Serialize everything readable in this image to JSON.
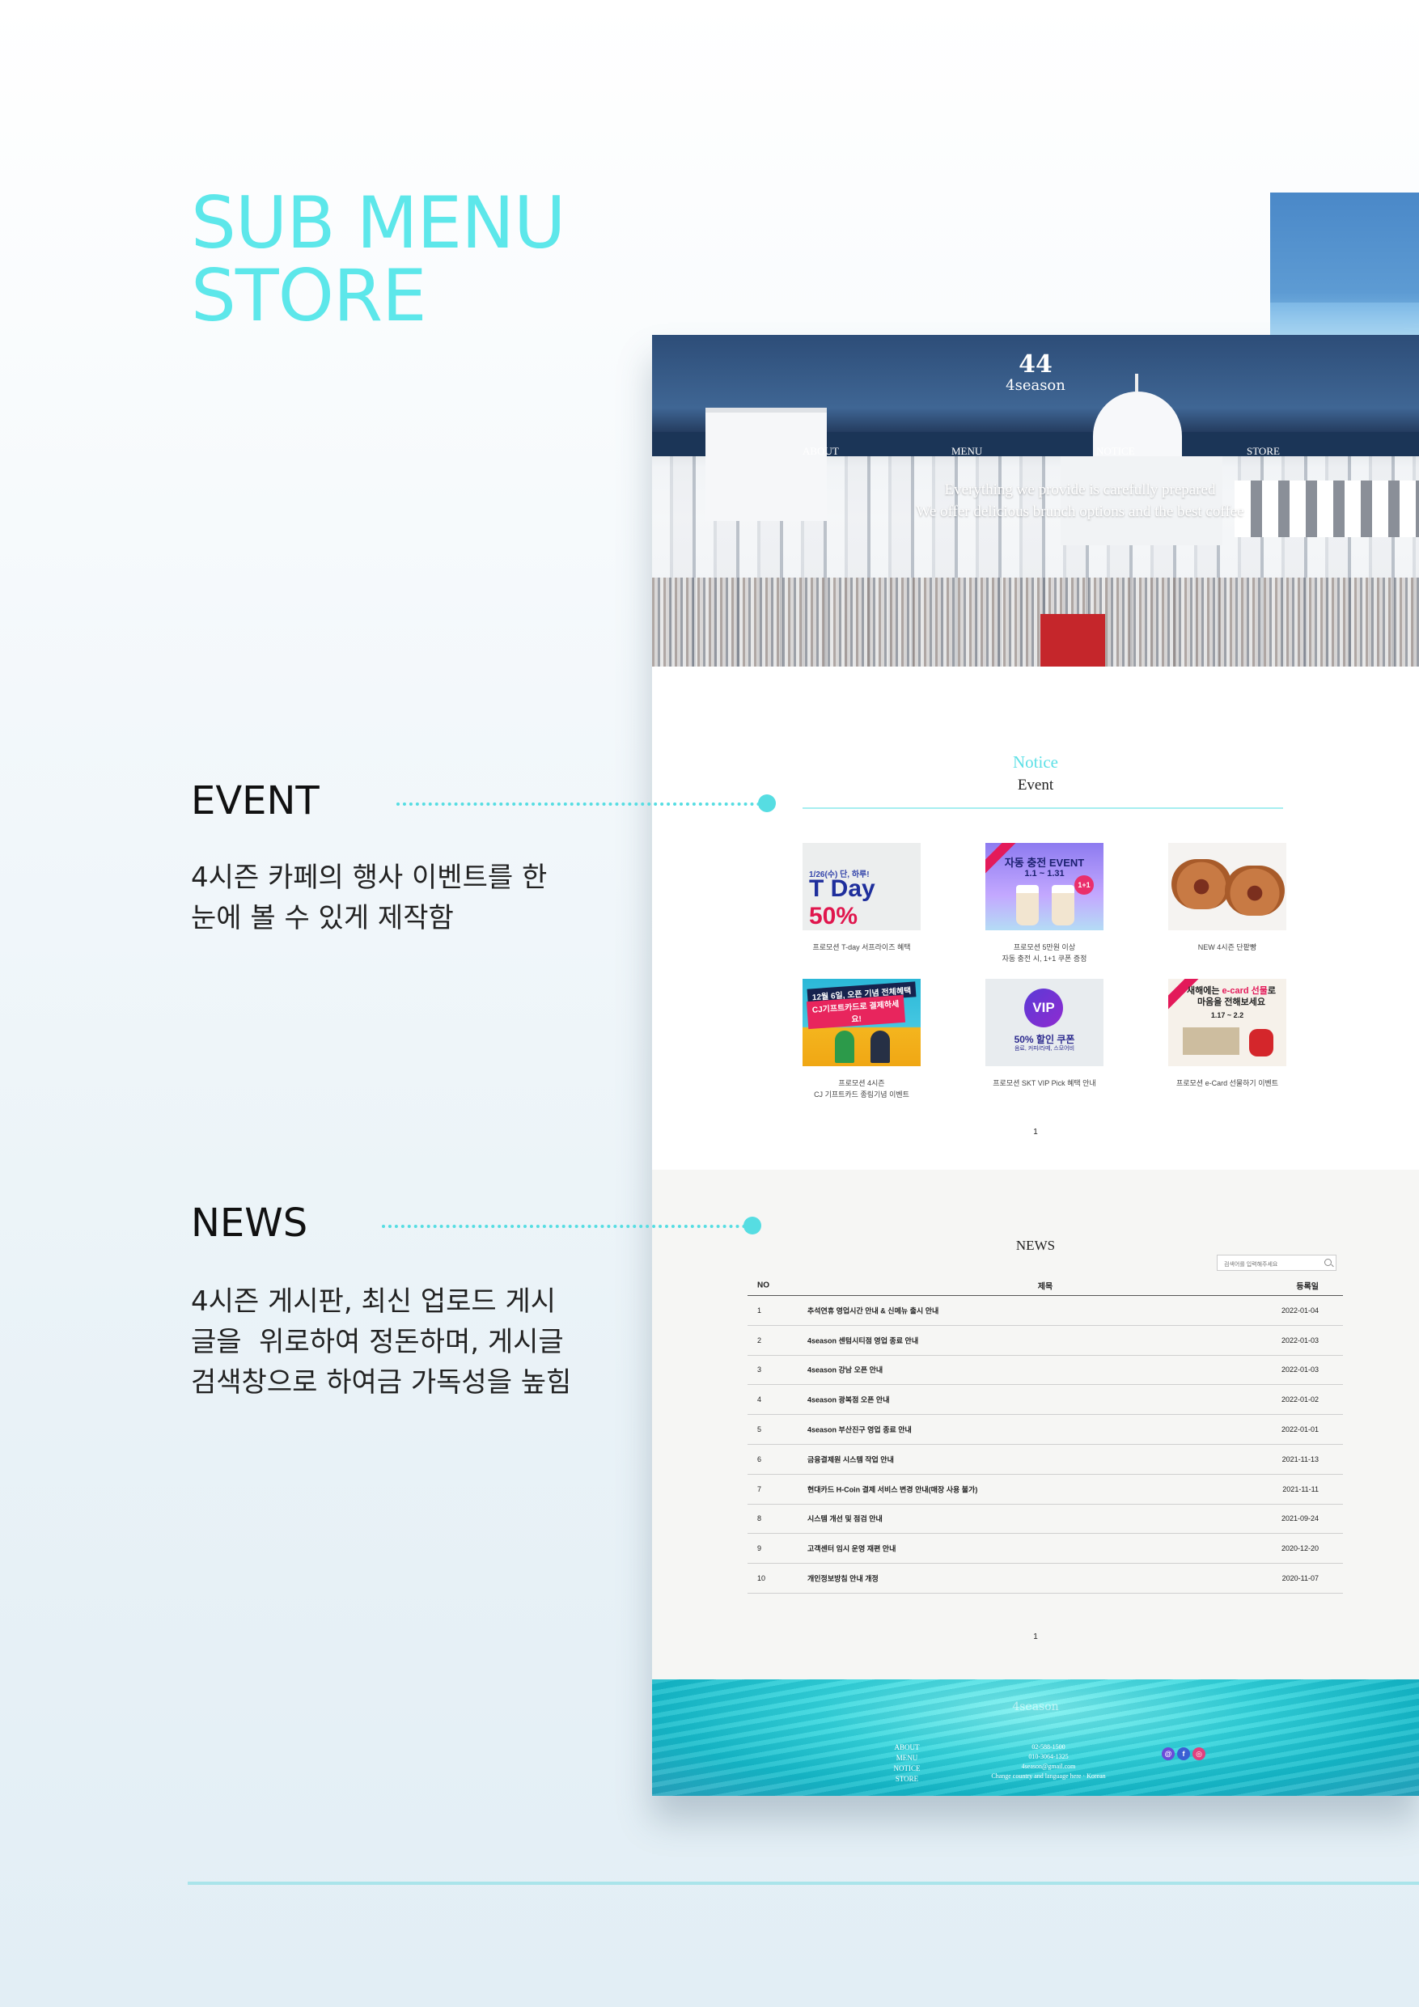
{
  "page": {
    "title_lines": [
      "SUB MENU",
      "STORE"
    ],
    "accent_color": "#5de7ea"
  },
  "hero": {
    "logo_mark": "44",
    "logo_name": "4season",
    "nav": [
      "ABOUT",
      "MENU",
      "NOTICE",
      "STORE"
    ],
    "tagline_1": "Everything we provide is carefully prepared",
    "tagline_2": "We offer delicious brunch options and the best coffee"
  },
  "event_section": {
    "heading_en": "Notice",
    "heading_ko": "Event",
    "cards": [
      {
        "caption": "프로모션 T-day 서프라이즈 혜택",
        "thumb_small": "1/26(수) 단, 하루!",
        "thumb_main": "T Day",
        "thumb_accent": "50%"
      },
      {
        "caption": "프로모션 5만원 이상\n자동 충전 시, 1+1 쿠폰 증정",
        "thumb_title": "자동 충전 EVENT",
        "thumb_date": "1.1 ~ 1.31",
        "thumb_badge": "1+1"
      },
      {
        "caption": "NEW 4시즌 단팥빵"
      },
      {
        "caption": "프로모션 4시즌\nCJ 기프트카드 종림기념 이벤트",
        "thumb_line1": "12월 6일, 오픈 기념 전체혜택",
        "thumb_line2": "CJ기프트카드로 결제하세요!"
      },
      {
        "caption": "프로모션 SKT VIP Pick 혜택 안내",
        "thumb_badge": "VIP",
        "thumb_title": "50% 할인 쿠폰",
        "thumb_sub": "음료, 커피/라떼, 스모어비"
      },
      {
        "caption": "프로모션 e-Card 선물하기 이벤트",
        "thumb_title_a": "새해에는",
        "thumb_title_b": "e-card 선물",
        "thumb_title_c": "로",
        "thumb_title_d": "마음을 전해보세요",
        "thumb_date": "1.17 ~ 2.2"
      }
    ],
    "page_number": "1"
  },
  "news_section": {
    "title": "NEWS",
    "search_placeholder": "검색어를 입력해주세요",
    "columns": [
      "NO",
      "제목",
      "등록일"
    ],
    "rows": [
      {
        "no": "1",
        "title": "추석연휴 영업시간 안내 & 신메뉴 출시 안내",
        "date": "2022-01-04"
      },
      {
        "no": "2",
        "title": "4season 센텀시티점 영업 종료 안내",
        "date": "2022-01-03"
      },
      {
        "no": "3",
        "title": "4season 강남 오픈 안내",
        "date": "2022-01-03"
      },
      {
        "no": "4",
        "title": "4season 광복점 오픈 안내",
        "date": "2022-01-02"
      },
      {
        "no": "5",
        "title": "4season 부산진구 영업 종료 안내",
        "date": "2022-01-01"
      },
      {
        "no": "6",
        "title": "금융결제원 시스템 작업 안내",
        "date": "2021-11-13"
      },
      {
        "no": "7",
        "title": "현대카드 H-Coin 결제 서비스 변경 안내(매장 사용 불가)",
        "date": "2021-11-11"
      },
      {
        "no": "8",
        "title": "시스템 개선 및 점검 안내",
        "date": "2021-09-24"
      },
      {
        "no": "9",
        "title": "고객센터 임시 운영 재편 안내",
        "date": "2020-12-20"
      },
      {
        "no": "10",
        "title": "개인정보방침 안내 개정",
        "date": "2020-11-07"
      }
    ],
    "page_number": "1"
  },
  "footer": {
    "logo": "4season",
    "nav": [
      "ABOUT",
      "MENU",
      "NOTICE",
      "STORE"
    ],
    "info": [
      "02-588-1500",
      "010-3064-1325",
      "4season@gmail.com",
      "Change country and language here · Korean"
    ],
    "social": [
      "gmail-icon",
      "facebook-icon",
      "instagram-icon"
    ]
  },
  "annotations": {
    "event_label": "EVENT",
    "event_desc": [
      "4시즌 카페의 행사 이벤트를 한",
      "눈에 볼 수 있게 제작함"
    ],
    "news_label": "NEWS",
    "news_desc": [
      "4시즌 게시판, 최신 업로드 게시",
      "글을  위로하여 정돈하며, 게시글",
      "검색창으로 하여금 가독성을 높힘"
    ]
  }
}
